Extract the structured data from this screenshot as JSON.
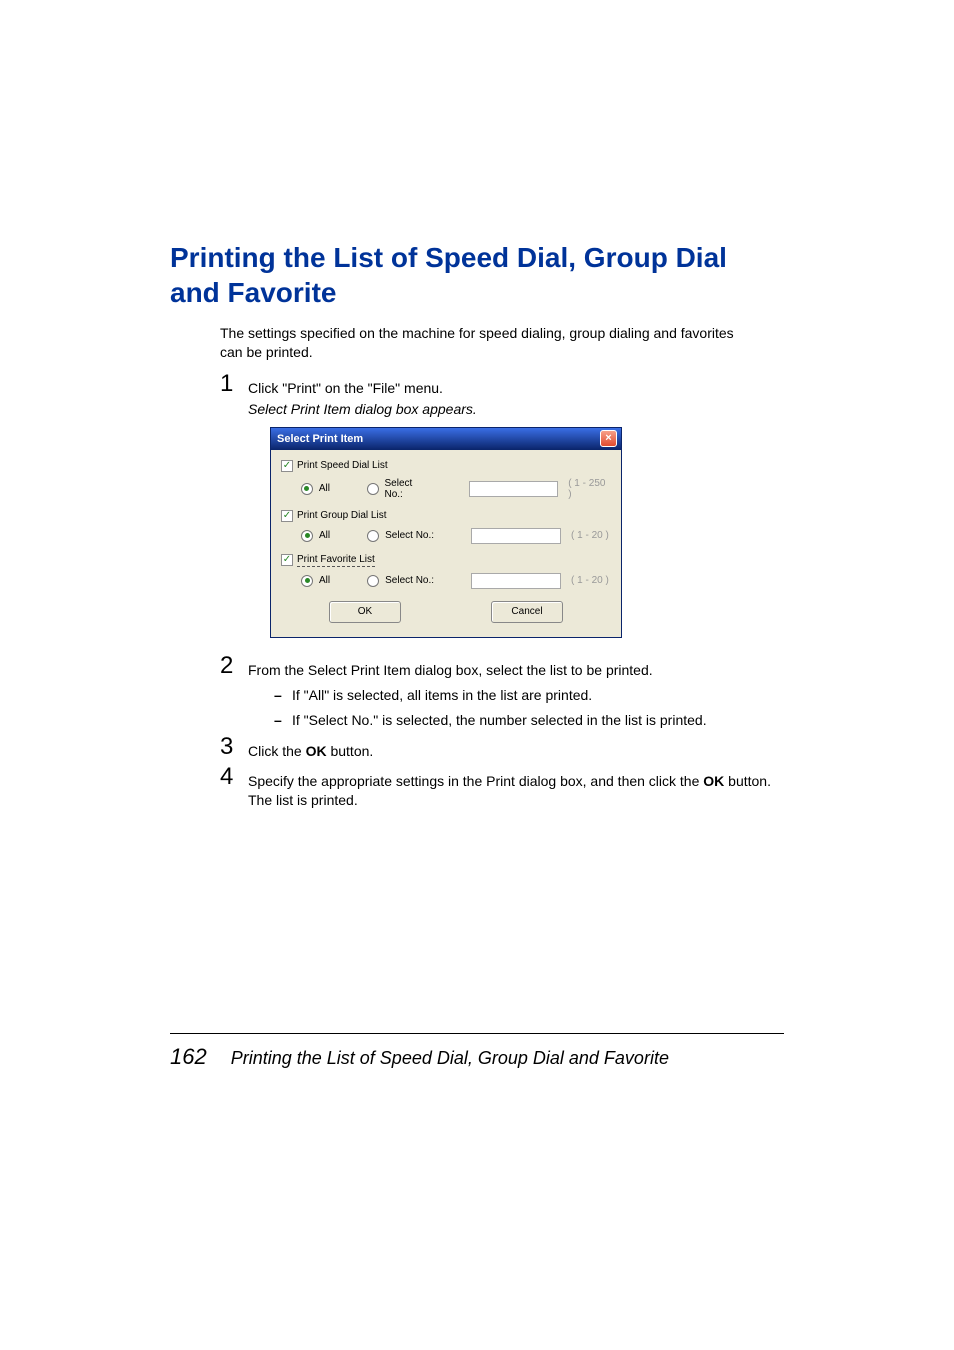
{
  "heading": "Printing the List of Speed Dial, Group Dial and Favorite",
  "intro": "The settings specified on the machine for speed dialing, group dialing and favorites can be printed.",
  "steps": {
    "s1": {
      "num": "1",
      "text": "Click \"Print\" on the \"File\" menu."
    },
    "s1_sub": "Select Print Item dialog box appears.",
    "s2": {
      "num": "2",
      "text": "From the Select Print Item dialog box, select the list to be printed."
    },
    "s2_bullets": [
      "If \"All\" is selected, all items in the list are printed.",
      "If \"Select No.\" is selected, the number selected in the list is printed."
    ],
    "s3": {
      "num": "3",
      "pre": "Click the ",
      "bold": "OK",
      "post": " button."
    },
    "s4": {
      "num": "4",
      "pre": "Specify the appropriate settings in the Print dialog box, and then click the ",
      "bold": "OK",
      "post": " button.",
      "after": "The list is printed."
    }
  },
  "dialog": {
    "title": "Select Print Item",
    "close": "×",
    "groups": [
      {
        "label": "Print Speed Dial List",
        "dotted": false,
        "range": "( 1 - 250 )"
      },
      {
        "label": "Print Group Dial List",
        "dotted": false,
        "range": "( 1 - 20 )"
      },
      {
        "label": "Print Favorite List",
        "dotted": true,
        "range": "( 1 - 20 )"
      }
    ],
    "radio_all": "All",
    "radio_select": "Select No.:",
    "ok": "OK",
    "cancel": "Cancel"
  },
  "footer": {
    "page": "162",
    "title": "Printing the List of Speed Dial, Group Dial and Favorite"
  }
}
